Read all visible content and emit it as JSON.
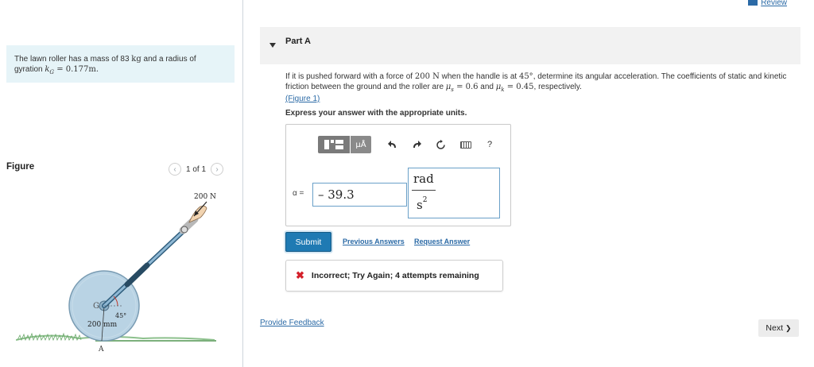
{
  "problem": {
    "text_before_mass": "The lawn roller has a mass of 83 ",
    "mass_unit": "kg",
    "text_after_mass": " and a radius of gyration ",
    "k_symbol": "k",
    "k_sub": "G",
    "k_value": " = 0.177m."
  },
  "figure_panel": {
    "header": "Figure",
    "counter": "1 of 1",
    "prev_icon": "chevron-left-icon",
    "next_icon": "chevron-right-icon",
    "labels": {
      "force": "200 N",
      "g_point": "G",
      "angle": "45°",
      "radius": "200 mm",
      "contact_point": "A"
    }
  },
  "review": {
    "label": "Review",
    "icon": "review-icon"
  },
  "part": {
    "title": "Part A",
    "question_start": "If it is pushed forward with a force of ",
    "force_value": "200 N",
    "question_mid1": " when the handle is at ",
    "angle_value": "45°",
    "question_mid2": ", determine its angular acceleration. The coefficients of static and kinetic friction between the ground and the roller are ",
    "mu_s": "μ",
    "mu_s_sub": "s",
    "mu_s_val": " = 0.6",
    "question_and": " and ",
    "mu_k": "μ",
    "mu_k_sub": "k",
    "mu_k_val": " = 0.45",
    "question_end": ", respectively.",
    "figure_link": "(Figure 1)",
    "instruction": "Express your answer with the appropriate units."
  },
  "toolbar": {
    "templates_icon": "templates-icon",
    "units_label": "μÅ",
    "undo_icon": "undo-icon",
    "redo_icon": "redo-icon",
    "reset_icon": "reset-icon",
    "keyboard_icon": "keyboard-icon",
    "help_label": "?"
  },
  "answer": {
    "variable_label": "α =",
    "value": "– 39.3",
    "unit_numerator": "rad",
    "unit_denominator": "s",
    "unit_exponent": "2"
  },
  "actions": {
    "submit": "Submit",
    "previous_answers": "Previous Answers",
    "request_answer": "Request Answer"
  },
  "feedback": {
    "icon": "x-icon",
    "symbol": "✖",
    "message": "Incorrect; Try Again; 4 attempts remaining"
  },
  "footer": {
    "provide_feedback": "Provide Feedback",
    "next": "Next",
    "next_symbol": "❯"
  },
  "colors": {
    "accent": "#1f7ab3",
    "link": "#2b6aa6",
    "error": "#d4202a",
    "problem_bg": "#e6f4f8"
  }
}
